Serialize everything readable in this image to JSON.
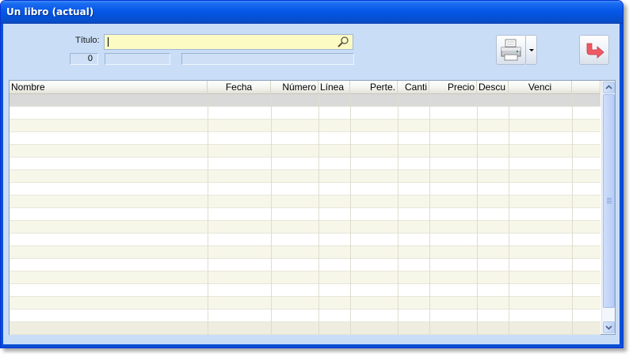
{
  "window": {
    "title": "Un libro (actual)"
  },
  "filter": {
    "title_label": "Título:",
    "title_value": "",
    "count": "0",
    "info1": "",
    "info2": ""
  },
  "toolbar": {
    "print_icon": "printer-icon",
    "print_menu_icon": "dropdown-arrow-icon",
    "exit_icon": "exit-arrow-icon"
  },
  "grid": {
    "columns": [
      {
        "label": "Nombre",
        "align": "left"
      },
      {
        "label": "Fecha",
        "align": "center"
      },
      {
        "label": "Número",
        "align": "right"
      },
      {
        "label": "Línea",
        "align": "left"
      },
      {
        "label": "Perte.",
        "align": "right"
      },
      {
        "label": "Canti",
        "align": "right"
      },
      {
        "label": "Precio",
        "align": "right"
      },
      {
        "label": "Descu",
        "align": "left"
      },
      {
        "label": "Venci",
        "align": "center"
      }
    ],
    "rows": []
  },
  "colors": {
    "title_bar": "#0758e8",
    "client_bg": "#c9ddf7",
    "search_bg": "#fbfbc3",
    "row_alt": "#f7f7e9",
    "row_selected": "#d9d9d9",
    "exit_icon": "#e8505b"
  }
}
